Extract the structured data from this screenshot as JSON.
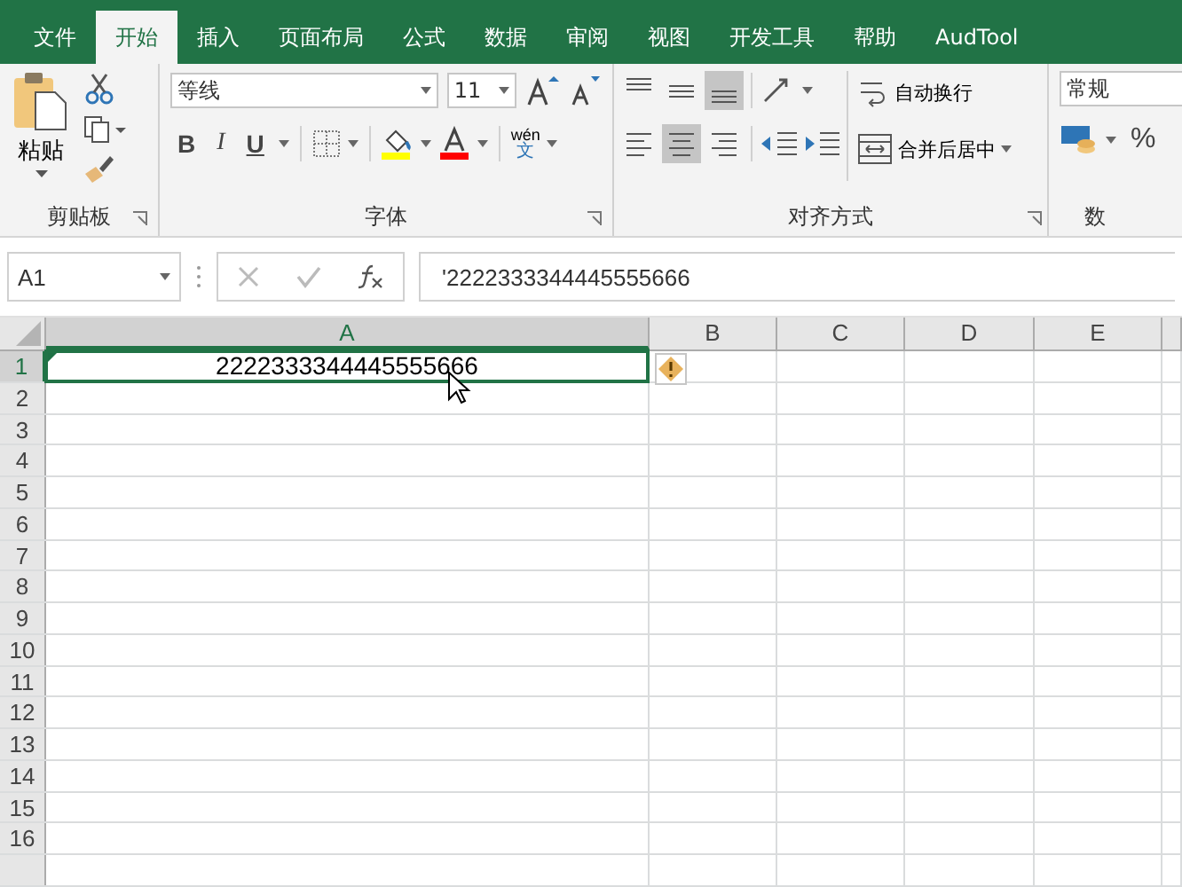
{
  "tabs": [
    {
      "label": "文件",
      "selected": false
    },
    {
      "label": "开始",
      "selected": true
    },
    {
      "label": "插入",
      "selected": false
    },
    {
      "label": "页面布局",
      "selected": false
    },
    {
      "label": "公式",
      "selected": false
    },
    {
      "label": "数据",
      "selected": false
    },
    {
      "label": "审阅",
      "selected": false
    },
    {
      "label": "视图",
      "selected": false
    },
    {
      "label": "开发工具",
      "selected": false
    },
    {
      "label": "帮助",
      "selected": false
    },
    {
      "label": "AudTool",
      "selected": false
    }
  ],
  "clipboard": {
    "paste": "粘贴",
    "group_label": "剪贴板"
  },
  "font": {
    "name": "等线",
    "size": "11",
    "bold": "B",
    "italic": "I",
    "underline": "U",
    "phonetic_top": "wén",
    "phonetic_bottom": "文",
    "group_label": "字体"
  },
  "alignment": {
    "vertical": [
      {
        "kind": "top",
        "selected": false
      },
      {
        "kind": "middle",
        "selected": false
      },
      {
        "kind": "bottom",
        "selected": true
      }
    ],
    "horizontal": [
      {
        "kind": "left",
        "selected": false
      },
      {
        "kind": "center",
        "selected": true
      },
      {
        "kind": "right",
        "selected": false
      }
    ],
    "wrap_text": "自动换行",
    "merge_center": "合并后居中",
    "group_label": "对齐方式"
  },
  "number": {
    "format": "常规",
    "percent": "%",
    "group_label": "数"
  },
  "formula_bar": {
    "name_box": "A1",
    "content": "'2222333344445555666"
  },
  "sheet": {
    "columns": [
      {
        "label": "A",
        "selected": true
      },
      {
        "label": "B",
        "selected": false
      },
      {
        "label": "C",
        "selected": false
      },
      {
        "label": "D",
        "selected": false
      },
      {
        "label": "E",
        "selected": false
      }
    ],
    "rows": [
      {
        "label": "1",
        "selected": true,
        "cells": [
          "2222333344445555666"
        ]
      },
      {
        "label": "2",
        "selected": false,
        "cells": []
      },
      {
        "label": "3",
        "selected": false,
        "cells": []
      },
      {
        "label": "4",
        "selected": false,
        "cells": []
      },
      {
        "label": "5",
        "selected": false,
        "cells": []
      },
      {
        "label": "6",
        "selected": false,
        "cells": []
      },
      {
        "label": "7",
        "selected": false,
        "cells": []
      },
      {
        "label": "8",
        "selected": false,
        "cells": []
      },
      {
        "label": "9",
        "selected": false,
        "cells": []
      },
      {
        "label": "10",
        "selected": false,
        "cells": []
      },
      {
        "label": "11",
        "selected": false,
        "cells": []
      },
      {
        "label": "12",
        "selected": false,
        "cells": []
      },
      {
        "label": "13",
        "selected": false,
        "cells": []
      },
      {
        "label": "14",
        "selected": false,
        "cells": []
      },
      {
        "label": "15",
        "selected": false,
        "cells": []
      },
      {
        "label": "16",
        "selected": false,
        "cells": []
      }
    ]
  }
}
